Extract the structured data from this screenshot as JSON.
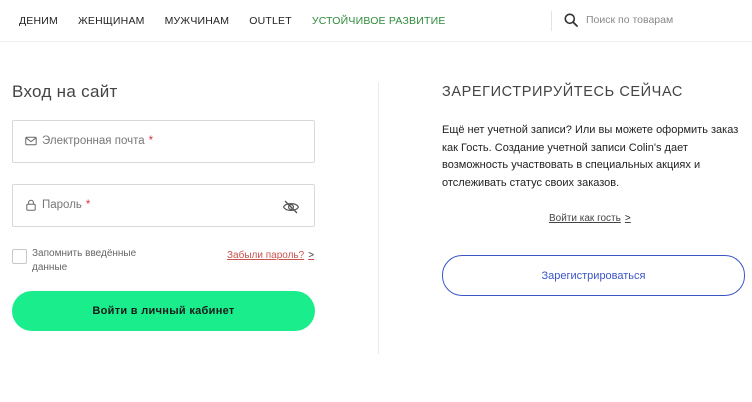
{
  "nav": {
    "items": [
      {
        "label": "ДЕНИМ"
      },
      {
        "label": "ЖЕНЩИНАМ"
      },
      {
        "label": "МУЖЧИНАМ"
      },
      {
        "label": "OUTLET"
      },
      {
        "label": "УСТОЙЧИВОЕ РАЗВИТИЕ"
      }
    ],
    "accent_color": "#2e8b3a"
  },
  "search": {
    "placeholder": "Поиск по товарам",
    "icon": "search-icon"
  },
  "login": {
    "title": "Вход на сайт",
    "email_label": "Электронная почта",
    "password_label": "Пароль",
    "required_mark": "*",
    "remember_label": "Запомнить введённые данные",
    "forgot_label": "Забыли пароль?",
    "arrow": ">",
    "button_label": "Войти в личный кабинет",
    "button_color": "#1aed8c"
  },
  "register": {
    "title": "ЗАРЕГИСТРИРУЙТЕСЬ СЕЙЧАС",
    "text": "Ещё нет учетной записи? Или вы можете оформить заказ как Гость. Создание учетной записи Colin's дает возможность участвовать в специальных акциях и отслеживать статус своих заказов.",
    "guest_label": "Войти как гость",
    "arrow": ">",
    "button_label": "Зарегистрироваться",
    "button_color": "#3b55c9"
  }
}
